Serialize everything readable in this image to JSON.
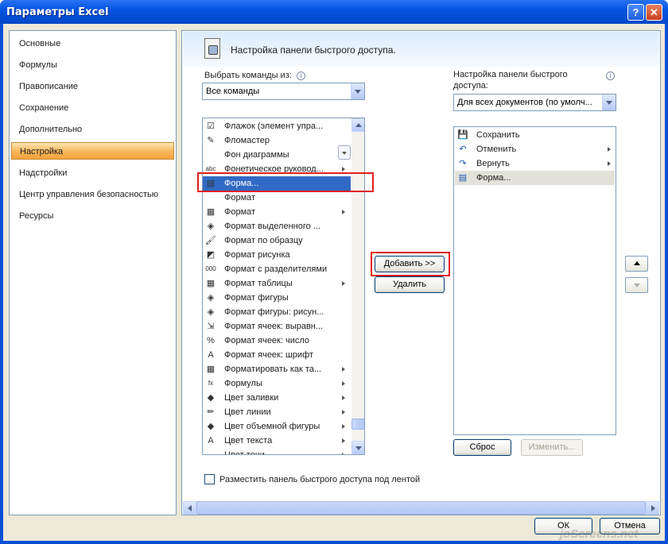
{
  "window": {
    "title": "Параметры Excel",
    "help": "?",
    "close": "✕"
  },
  "nav": {
    "items": [
      "Основные",
      "Формулы",
      "Правописание",
      "Сохранение",
      "Дополнительно",
      "Настройка",
      "Надстройки",
      "Центр управления безопасностью",
      "Ресурсы"
    ],
    "selected": "Настройка"
  },
  "banner": {
    "text": "Настройка панели быстрого доступа."
  },
  "left": {
    "label": "Выбрать команды из:",
    "combo_value": "Все команды"
  },
  "right": {
    "label_line1": "Настройка панели быстрого",
    "label_line2": "доступа:",
    "combo_value": "Для всех документов (по умолч..."
  },
  "commands": [
    {
      "label": "Флажок (элемент упра...",
      "icon": "checkbox-icon",
      "glyph": "☑",
      "arrow": false
    },
    {
      "label": "Фломастер",
      "icon": "marker-icon",
      "glyph": "✎",
      "arrow": false
    },
    {
      "label": "Фон диаграммы",
      "icon": "chart-background-icon",
      "glyph": "",
      "arrow": false
    },
    {
      "label": "Фонетическое руковод...",
      "icon": "phonetic-guide-icon",
      "glyph": "abc",
      "arrow": true
    },
    {
      "label": "Форма...",
      "icon": "form-icon",
      "glyph": "▤",
      "arrow": false
    },
    {
      "label": "Формат",
      "icon": "format-icon",
      "glyph": "",
      "arrow": false
    },
    {
      "label": "Формат",
      "icon": "format-cells-icon",
      "glyph": "▦",
      "arrow": true
    },
    {
      "label": "Формат выделенного ...",
      "icon": "format-selection-icon",
      "glyph": "◈",
      "arrow": false
    },
    {
      "label": "Формат по образцу",
      "icon": "format-painter-icon",
      "glyph": "🖌",
      "arrow": false
    },
    {
      "label": "Формат рисунка",
      "icon": "format-picture-icon",
      "glyph": "◩",
      "arrow": false
    },
    {
      "label": "Формат с разделителями",
      "icon": "comma-style-icon",
      "glyph": "000",
      "arrow": false
    },
    {
      "label": "Формат таблицы",
      "icon": "format-table-icon",
      "glyph": "▦",
      "arrow": true
    },
    {
      "label": "Формат фигуры",
      "icon": "format-shape-icon",
      "glyph": "◈",
      "arrow": false
    },
    {
      "label": "Формат фигуры: рисун...",
      "icon": "format-shape-picture-icon",
      "glyph": "◈",
      "arrow": false
    },
    {
      "label": "Формат ячеек: выравн...",
      "icon": "align-cells-icon",
      "glyph": "⇲",
      "arrow": false
    },
    {
      "label": "Формат ячеек: число",
      "icon": "percent-icon",
      "glyph": "%",
      "arrow": false
    },
    {
      "label": "Формат ячеек: шрифт",
      "icon": "font-icon",
      "glyph": "A",
      "arrow": false
    },
    {
      "label": "Форматировать как та...",
      "icon": "format-as-table-icon",
      "glyph": "▦",
      "arrow": true
    },
    {
      "label": "Формулы",
      "icon": "formulas-icon",
      "glyph": "fx",
      "arrow": true
    },
    {
      "label": "Цвет заливки",
      "icon": "fill-color-icon",
      "glyph": "◆",
      "arrow": true
    },
    {
      "label": "Цвет линии",
      "icon": "line-color-icon",
      "glyph": "✏",
      "arrow": true
    },
    {
      "label": "Цвет объемной фигуры",
      "icon": "3d-color-icon",
      "glyph": "◆",
      "arrow": true
    },
    {
      "label": "Цвет текста",
      "icon": "font-color-icon",
      "glyph": "A",
      "arrow": true
    },
    {
      "label": "Цвет тени",
      "icon": "shadow-color-icon",
      "glyph": "",
      "arrow": true
    }
  ],
  "selected_command": "Форма...",
  "buttons": {
    "add": "Добавить >>",
    "remove": "Удалить",
    "reset": "Сброс",
    "modify": "Изменить...",
    "ok": "ОК",
    "cancel": "Отмена"
  },
  "qat": [
    {
      "label": "Сохранить",
      "icon": "save-icon",
      "glyph": "💾",
      "arrow": false
    },
    {
      "label": "Отменить",
      "icon": "undo-icon",
      "glyph": "↶",
      "arrow": true
    },
    {
      "label": "Вернуть",
      "icon": "redo-icon",
      "glyph": "↷",
      "arrow": true
    },
    {
      "label": "Форма...",
      "icon": "form-icon",
      "glyph": "▤",
      "arrow": false
    }
  ],
  "checkbox": {
    "label": "Разместить панель быстрого доступа под лентой",
    "checked": false
  },
  "watermark": "joScreens.net",
  "colors": {
    "highlight": "#e02020",
    "selection": "#316ac5",
    "title_bar": "#0554e2"
  }
}
